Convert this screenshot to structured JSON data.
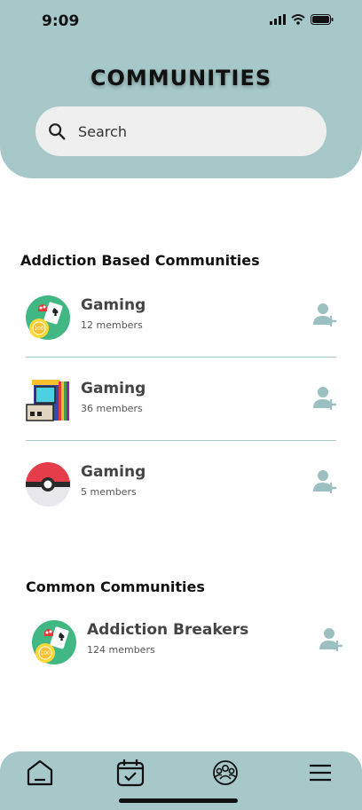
{
  "status_bar": {
    "time": "9:09"
  },
  "header": {
    "title": "COMMUNITIES"
  },
  "search": {
    "placeholder": "Search"
  },
  "sections": [
    {
      "title": "Addiction Based Communities",
      "items": [
        {
          "name": "Gaming",
          "members": "12 members",
          "icon": "casino-chips-icon"
        },
        {
          "name": "Gaming",
          "members": "36 members",
          "icon": "arcade-machine-icon"
        },
        {
          "name": "Gaming",
          "members": "5 members",
          "icon": "pokeball-icon"
        }
      ]
    },
    {
      "title": "Common Communities",
      "items": [
        {
          "name": "Addiction Breakers",
          "members": "124 members",
          "icon": "casino-chips-icon"
        }
      ]
    }
  ],
  "bottom_nav": {
    "items": [
      "home-icon",
      "calendar-check-icon",
      "community-icon",
      "menu-icon"
    ]
  },
  "colors": {
    "accent": "#a6c8c9",
    "icon_muted": "#9cbfc1"
  }
}
